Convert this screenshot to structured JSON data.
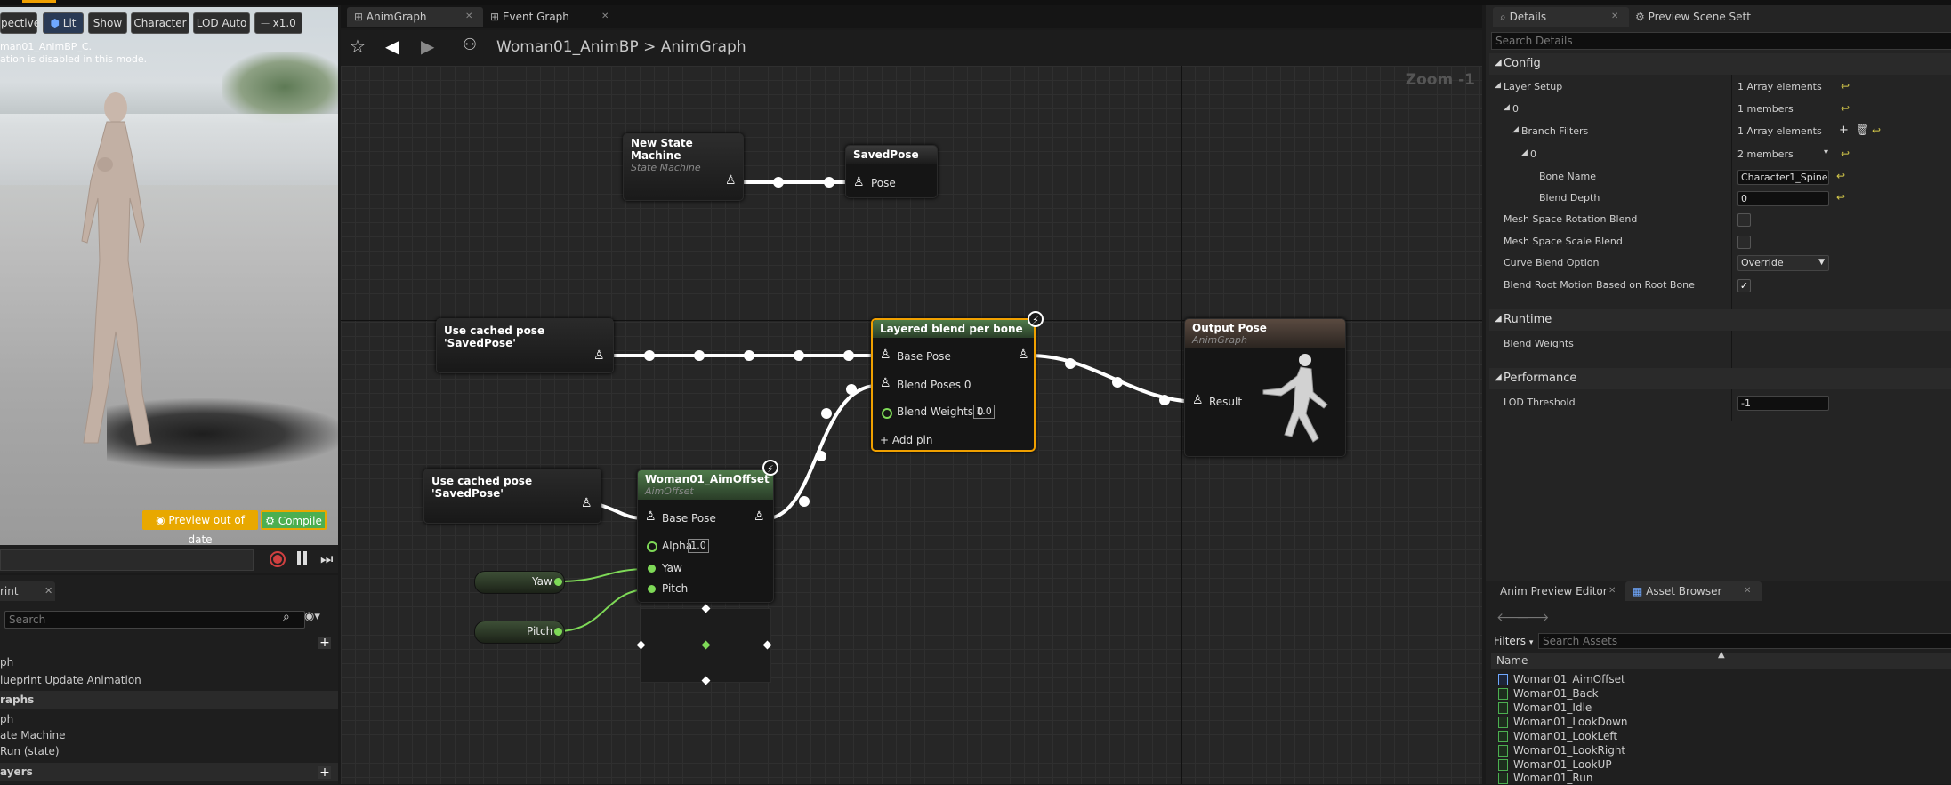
{
  "viewport": {
    "toolbar": {
      "perspective": "pective",
      "lit": "Lit",
      "show": "Show",
      "character": "Character",
      "lod": "LOD Auto",
      "speed": "x1.0"
    },
    "overlay_line1": "man01_AnimBP_C.",
    "overlay_line2": "ation is disabled in this mode.",
    "preview_out_of_date": "Preview out of date",
    "compile": "Compile"
  },
  "left_panel": {
    "tab_label": "rint",
    "search_placeholder": "Search",
    "rows": [
      "ph",
      "lueprint Update Animation",
      "raphs",
      "ph",
      "ate Machine",
      "Run (state)",
      "ayers"
    ]
  },
  "graph_tabs": [
    {
      "label": "AnimGraph",
      "icon": "graph-icon"
    },
    {
      "label": "Event Graph",
      "icon": "graph-icon"
    }
  ],
  "breadcrumb": {
    "blueprint": "Woman01_AnimBP",
    "separator": ">",
    "graph": "AnimGraph"
  },
  "zoom": "Zoom -1",
  "nodes": {
    "state_machine": {
      "title": "New State Machine",
      "subtitle": "State Machine"
    },
    "saved_pose": {
      "title": "SavedPose",
      "pin": "Pose"
    },
    "cached_pose_1": {
      "title": "Use cached pose 'SavedPose'"
    },
    "cached_pose_2": {
      "title": "Use cached pose 'SavedPose'"
    },
    "layered_blend": {
      "title": "Layered blend per bone",
      "base_pose": "Base Pose",
      "blend_poses": "Blend Poses 0",
      "blend_weights": "Blend Weights 0",
      "blend_weights_value": "1.0",
      "add_pin": "Add pin"
    },
    "output_pose": {
      "title": "Output Pose",
      "subtitle": "AnimGraph",
      "result": "Result"
    },
    "aim_offset": {
      "title": "Woman01_AimOffset",
      "subtitle": "AimOffset",
      "base_pose": "Base Pose",
      "alpha": "Alpha",
      "alpha_value": "1.0",
      "yaw": "Yaw",
      "pitch": "Pitch"
    },
    "yaw_var": "Yaw",
    "pitch_var": "Pitch"
  },
  "details": {
    "tabs": [
      "Details",
      "Preview Scene Sett"
    ],
    "search_placeholder": "Search Details",
    "sections": {
      "config": "Config",
      "runtime": "Runtime",
      "performance": "Performance"
    },
    "rows": {
      "layer_setup": {
        "label": "Layer Setup",
        "value": "1 Array elements"
      },
      "index0": {
        "label": "0",
        "value": "1 members"
      },
      "branch_filters": {
        "label": "Branch Filters",
        "value": "1 Array elements"
      },
      "bf_index0": {
        "label": "0",
        "value": "2 members"
      },
      "bone_name": {
        "label": "Bone Name",
        "value": "Character1_Spine"
      },
      "blend_depth": {
        "label": "Blend Depth",
        "value": "0"
      },
      "mesh_rot": {
        "label": "Mesh Space Rotation Blend"
      },
      "mesh_scale": {
        "label": "Mesh Space Scale Blend"
      },
      "curve_blend": {
        "label": "Curve Blend Option",
        "value": "Override"
      },
      "blend_root": {
        "label": "Blend Root Motion Based on Root Bone"
      },
      "blend_weights": {
        "label": "Blend Weights"
      },
      "lod_threshold": {
        "label": "LOD Threshold",
        "value": "-1"
      }
    }
  },
  "asset_browser": {
    "tabs": [
      "Anim Preview Editor",
      "Asset Browser"
    ],
    "filters": "Filters",
    "search_placeholder": "Search Assets",
    "column_name": "Name",
    "items": [
      "Woman01_AimOffset",
      "Woman01_Back",
      "Woman01_Idle",
      "Woman01_LookDown",
      "Woman01_LookLeft",
      "Woman01_LookRight",
      "Woman01_LookUP",
      "Woman01_Run"
    ]
  },
  "colors": {
    "accent_orange": "#f0a000",
    "pin_green": "#7ed957",
    "compile_green": "#4caf50",
    "warning_yellow": "#e8a800"
  }
}
